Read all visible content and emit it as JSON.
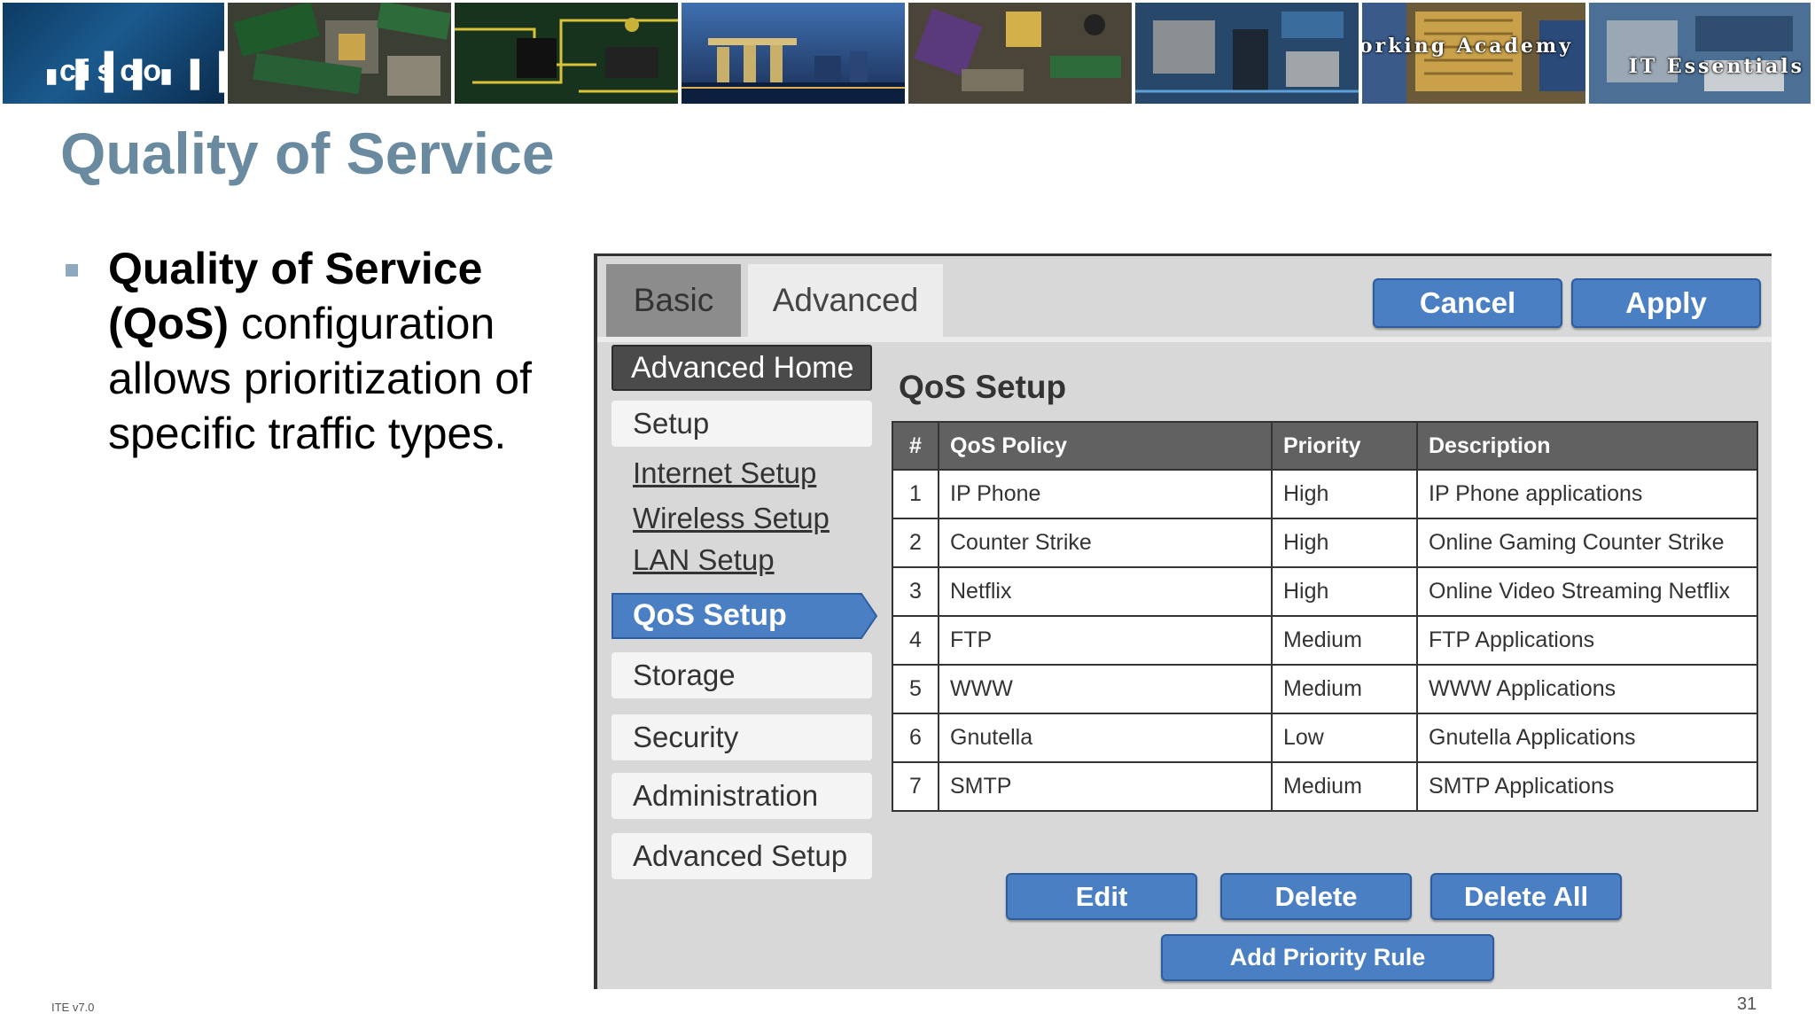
{
  "banner": {
    "logo_text": "cisco",
    "academy_line1": "Cisco Networking Academy",
    "academy_line2": "IT Essentials"
  },
  "slide": {
    "title": "Quality of Service",
    "bullet_bold_1": "Quality of Service",
    "bullet_bold_2": "(QoS)",
    "bullet_rest": " configuration allows prioritization of specific traffic types.",
    "footer_left": "ITE v7.0",
    "page_number": "31"
  },
  "router": {
    "tabs": {
      "basic": "Basic",
      "advanced": "Advanced"
    },
    "actions": {
      "cancel": "Cancel",
      "apply": "Apply"
    },
    "nav": {
      "home": "Advanced Home",
      "setup": "Setup",
      "internet_setup": "Internet Setup",
      "wireless_setup": "Wireless Setup",
      "lan_setup": "LAN Setup",
      "qos_setup": "QoS Setup",
      "storage": "Storage",
      "security": "Security",
      "administration": "Administration",
      "advanced_setup": "Advanced Setup"
    },
    "content": {
      "heading": "QoS Setup",
      "columns": [
        "#",
        "QoS Policy",
        "Priority",
        "Description"
      ],
      "rows": [
        [
          "1",
          "IP Phone",
          "High",
          "IP Phone applications"
        ],
        [
          "2",
          "Counter Strike",
          "High",
          "Online Gaming Counter Strike"
        ],
        [
          "3",
          "Netflix",
          "High",
          "Online Video Streaming Netflix"
        ],
        [
          "4",
          "FTP",
          "Medium",
          "FTP Applications"
        ],
        [
          "5",
          "WWW",
          "Medium",
          "WWW Applications"
        ],
        [
          "6",
          "Gnutella",
          "Low",
          "Gnutella Applications"
        ],
        [
          "7",
          "SMTP",
          "Medium",
          "SMTP Applications"
        ]
      ],
      "buttons": {
        "edit": "Edit",
        "delete": "Delete",
        "delete_all": "Delete All",
        "add_rule": "Add Priority Rule"
      }
    }
  },
  "colors": {
    "title": "#6a8aa0",
    "button_blue": "#4a7fc3",
    "panel_gray": "#d8d8d8",
    "table_header": "#616161"
  }
}
